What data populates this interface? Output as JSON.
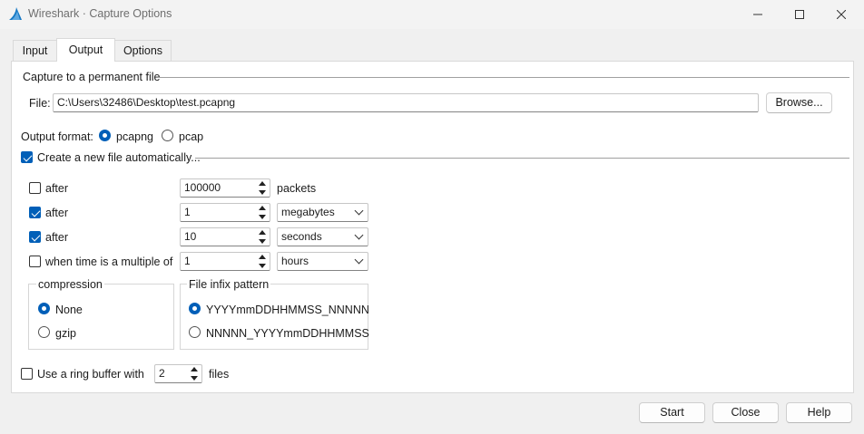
{
  "window": {
    "title": "Wireshark · Capture Options",
    "accent": "#005fb8",
    "controls": [
      "minimize-icon",
      "maximize-icon",
      "close-icon"
    ]
  },
  "tabs": [
    {
      "label": "Input"
    },
    {
      "label": "Output",
      "active": true
    },
    {
      "label": "Options"
    }
  ],
  "output": {
    "permanent_file_label": "Capture to a permanent file",
    "file_label": "File:",
    "file_value": "C:\\Users\\32486\\Desktop\\test.pcapng",
    "browse_label": "Browse...",
    "format_label": "Output format:",
    "format_options": [
      {
        "label": "pcapng",
        "selected": true
      },
      {
        "label": "pcap",
        "selected": false
      }
    ],
    "auto_new_file_label": "Create a new file automatically...",
    "auto_new_file_checked": true,
    "rules": [
      {
        "label": "after",
        "checked": false,
        "value": "100000",
        "unit": "packets"
      },
      {
        "label": "after",
        "checked": true,
        "value": "1",
        "unit": "megabytes"
      },
      {
        "label": "after",
        "checked": true,
        "value": "10",
        "unit": "seconds"
      },
      {
        "label": "when time is a multiple of",
        "checked": false,
        "value": "1",
        "unit": "hours"
      }
    ],
    "compression": {
      "title": "compression",
      "options": [
        {
          "label": "None",
          "selected": true
        },
        {
          "label": "gzip",
          "selected": false
        }
      ]
    },
    "infix": {
      "title": "File infix pattern",
      "options": [
        {
          "label": "YYYYmmDDHHMMSS_NNNNN",
          "selected": true
        },
        {
          "label": "NNNNN_YYYYmmDDHHMMSS",
          "selected": false
        }
      ]
    },
    "ring_buffer": {
      "label": "Use a ring buffer with",
      "checked": false,
      "value": "2",
      "unit": "files"
    }
  },
  "footer": {
    "start_label": "Start",
    "close_label": "Close",
    "help_label": "Help"
  }
}
